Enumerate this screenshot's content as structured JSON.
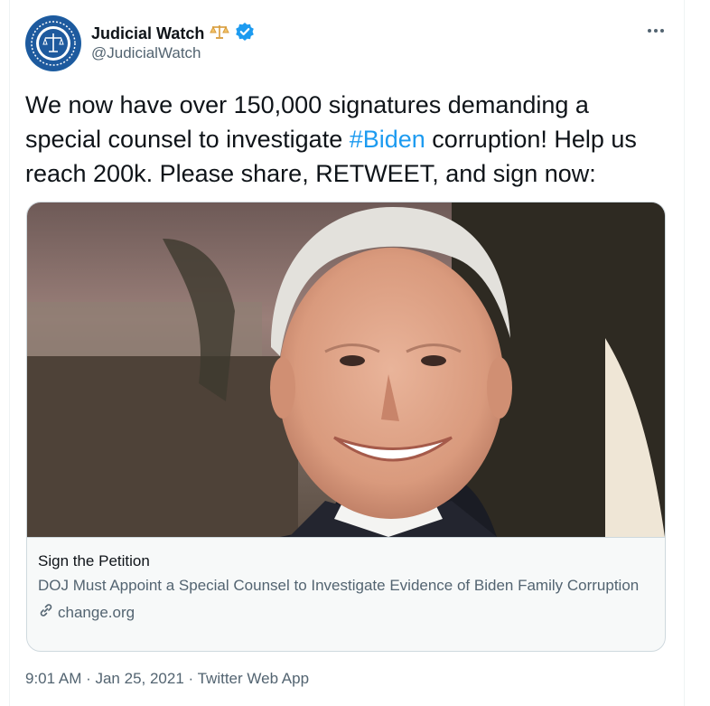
{
  "tweet": {
    "author_name": "Judicial Watch",
    "author_handle": "@JudicialWatch",
    "text_before": "We now have over 150,000 signatures demanding a special counsel to investigate ",
    "hashtag": "#Biden",
    "text_after": " corruption! Help us reach 200k. Please share, RETWEET, and sign now:",
    "timestamp": "9:01 AM · Jan 25, 2021 · ",
    "source": "Twitter Web App"
  },
  "card": {
    "label": "Sign the Petition",
    "title": "DOJ Must Appoint a Special Counsel to Investigate Evidence of Biden Family Corruption",
    "domain": "change.org"
  },
  "icons": {
    "verified": "verified-badge-icon",
    "scales": "scales-of-justice-icon",
    "more": "more-options-icon",
    "link": "link-icon"
  },
  "colors": {
    "accent": "#1d9bf0",
    "secondary_text": "#536471",
    "verified": "#1d9bf0",
    "scales": "#d79b3a"
  }
}
